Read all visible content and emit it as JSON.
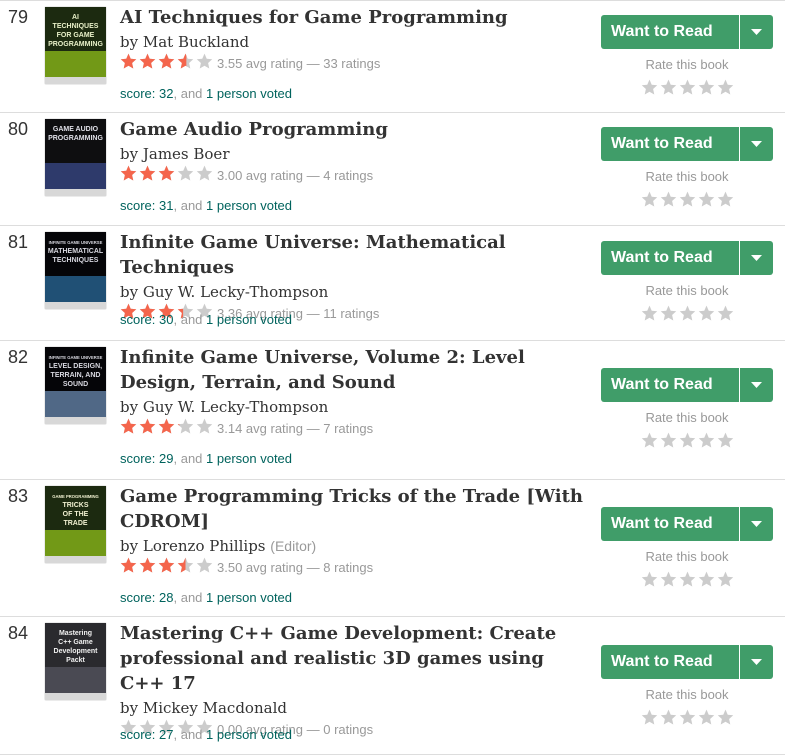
{
  "colors": {
    "star_filled": "#f4654c",
    "star_empty": "#cccccc",
    "button_green": "#409d69",
    "link_teal": "#00635d"
  },
  "rows": [
    {
      "rank": "79",
      "title": "AI Techniques for Game Programming",
      "by": "by",
      "author": "Mat Buckland",
      "role": "",
      "avg_rating": 3.55,
      "rating_text": "3.55 avg rating — 33 ratings",
      "score_text": "score: 32",
      "and_text": ", and ",
      "voters": "1 person voted",
      "want_to_read": "Want to Read",
      "rate_label": "Rate this book",
      "cover_lines": [
        "AI",
        "TECHNIQUES",
        "FOR GAME",
        "PROGRAMMING"
      ],
      "cover_icon": "book-cover-icon"
    },
    {
      "rank": "80",
      "title": "Game Audio Programming",
      "by": "by",
      "author": "James Boer",
      "role": "",
      "avg_rating": 3.0,
      "rating_text": "3.00 avg rating — 4 ratings",
      "score_text": "score: 31",
      "and_text": ", and ",
      "voters": "1 person voted",
      "want_to_read": "Want to Read",
      "rate_label": "Rate this book",
      "cover_lines": [
        "GAME AUDIO",
        "PROGRAMMING"
      ],
      "cover_icon": "book-cover-icon"
    },
    {
      "rank": "81",
      "title": "Infinite Game Universe: Mathematical Techniques",
      "by": "by",
      "author": "Guy W. Lecky-Thompson",
      "role": "",
      "avg_rating": 3.36,
      "rating_text": "3.36 avg rating — 11 ratings",
      "score_text": "score: 30",
      "and_text": ", and ",
      "voters": "1 person voted",
      "want_to_read": "Want to Read",
      "rate_label": "Rate this book",
      "cover_lines": [
        "INFINITE GAME UNIVERSE",
        "MATHEMATICAL",
        "TECHNIQUES"
      ],
      "cover_icon": "book-cover-icon"
    },
    {
      "rank": "82",
      "title": "Infinite Game Universe, Volume 2: Level Design, Terrain, and Sound",
      "by": "by",
      "author": "Guy W. Lecky-Thompson",
      "role": "",
      "avg_rating": 3.14,
      "rating_text": "3.14 avg rating — 7 ratings",
      "score_text": "score: 29",
      "and_text": ", and ",
      "voters": "1 person voted",
      "want_to_read": "Want to Read",
      "rate_label": "Rate this book",
      "cover_lines": [
        "INFINITE GAME UNIVERSE",
        "LEVEL DESIGN,",
        "TERRAIN, AND",
        "SOUND"
      ],
      "cover_icon": "book-cover-icon"
    },
    {
      "rank": "83",
      "title": "Game Programming Tricks of the Trade [With CDROM]",
      "by": "by",
      "author": "Lorenzo Phillips",
      "role": "(Editor)",
      "avg_rating": 3.5,
      "rating_text": "3.50 avg rating — 8 ratings",
      "score_text": "score: 28",
      "and_text": ", and ",
      "voters": "1 person voted",
      "want_to_read": "Want to Read",
      "rate_label": "Rate this book",
      "cover_lines": [
        "GAME PROGRAMMING",
        "TRICKS",
        "OF THE",
        "TRADE"
      ],
      "cover_icon": "book-cover-icon"
    },
    {
      "rank": "84",
      "title": "Mastering C++ Game Development: Create professional and realistic 3D games using C++ 17",
      "by": "by",
      "author": "Mickey Macdonald",
      "role": "",
      "avg_rating": 0,
      "rating_text": "0.00 avg rating — 0 ratings",
      "score_text": "score: 27",
      "and_text": ", and ",
      "voters": "1 person voted",
      "want_to_read": "Want to Read",
      "rate_label": "Rate this book",
      "cover_lines": [
        "Mastering",
        "C++ Game",
        "Development",
        "Packt"
      ],
      "cover_icon": "book-cover-icon"
    }
  ]
}
